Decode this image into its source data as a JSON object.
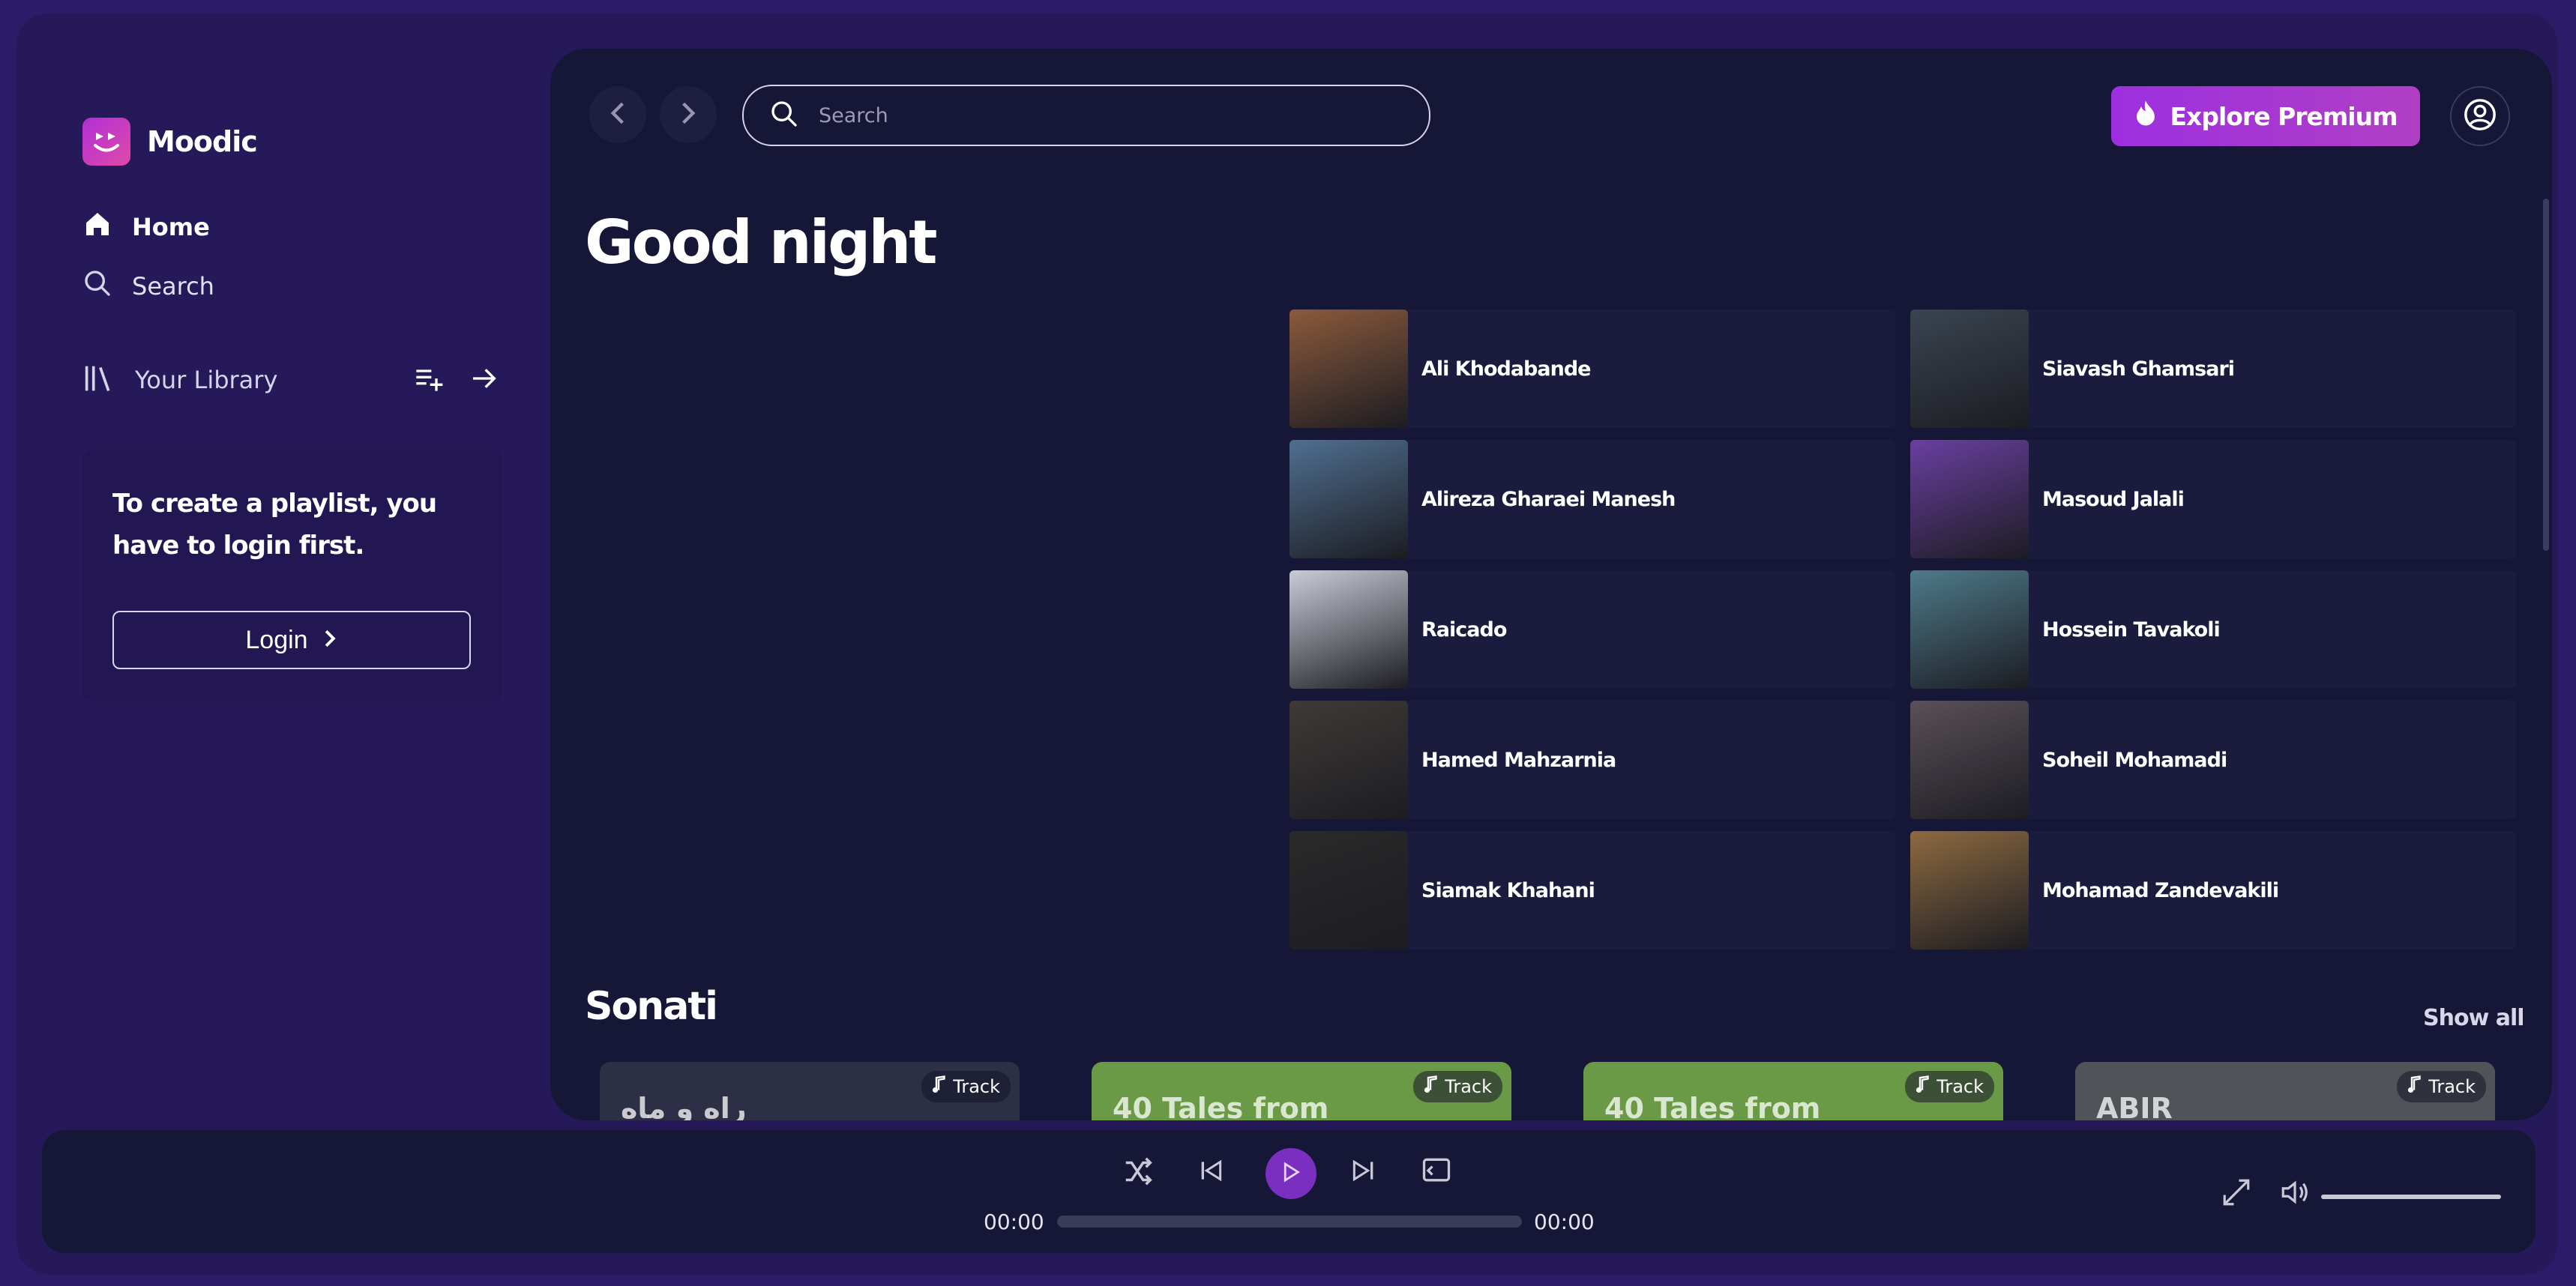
{
  "app": {
    "name": "Moodic"
  },
  "sidebar": {
    "nav": [
      {
        "label": "Home",
        "icon": "home-icon"
      },
      {
        "label": "Search",
        "icon": "search-icon"
      }
    ],
    "library": {
      "label": "Your Library",
      "icon": "library-icon"
    },
    "login_card": {
      "message": "To create a playlist, you have to login first.",
      "button_label": "Login"
    }
  },
  "header": {
    "search_placeholder": "Search",
    "premium_label": "Explore Premium"
  },
  "main": {
    "greeting": "Good night",
    "artists": [
      {
        "name": "Ali Khodabande",
        "color": "#8b5a3c"
      },
      {
        "name": "Siavash Ghamsari",
        "color": "#3a4450"
      },
      {
        "name": "Alireza Gharaei Manesh",
        "color": "#4f6f90"
      },
      {
        "name": "Masoud Jalali",
        "color": "#6a3fa0"
      },
      {
        "name": "Raicado",
        "color": "#c9cbd6"
      },
      {
        "name": "Hossein Tavakoli",
        "color": "#4e7a8a"
      },
      {
        "name": "Hamed Mahzarnia",
        "color": "#3f3a36"
      },
      {
        "name": "Soheil Mohamadi",
        "color": "#5a5058"
      },
      {
        "name": "Siamak Khahani",
        "color": "#2a2a2a"
      },
      {
        "name": "Mohamad Zandevakili",
        "color": "#8d6a40"
      }
    ],
    "section": {
      "title": "Sonati",
      "show_all": "Show all",
      "tracks": [
        {
          "badge": "Track",
          "cover_text": "راه و ماه",
          "color": "#2c2f45"
        },
        {
          "badge": "Track",
          "cover_text": "40 Tales from",
          "color": "#6a9a45"
        },
        {
          "badge": "Track",
          "cover_text": "40 Tales from",
          "color": "#6a9a45"
        },
        {
          "badge": "Track",
          "cover_text": "ABIR",
          "color": "#505458"
        }
      ]
    }
  },
  "player": {
    "current_time": "00:00",
    "total_time": "00:00",
    "progress": 0
  },
  "colors": {
    "accent": "#9d2fe0",
    "background": "#26195a",
    "panel": "#161737"
  }
}
